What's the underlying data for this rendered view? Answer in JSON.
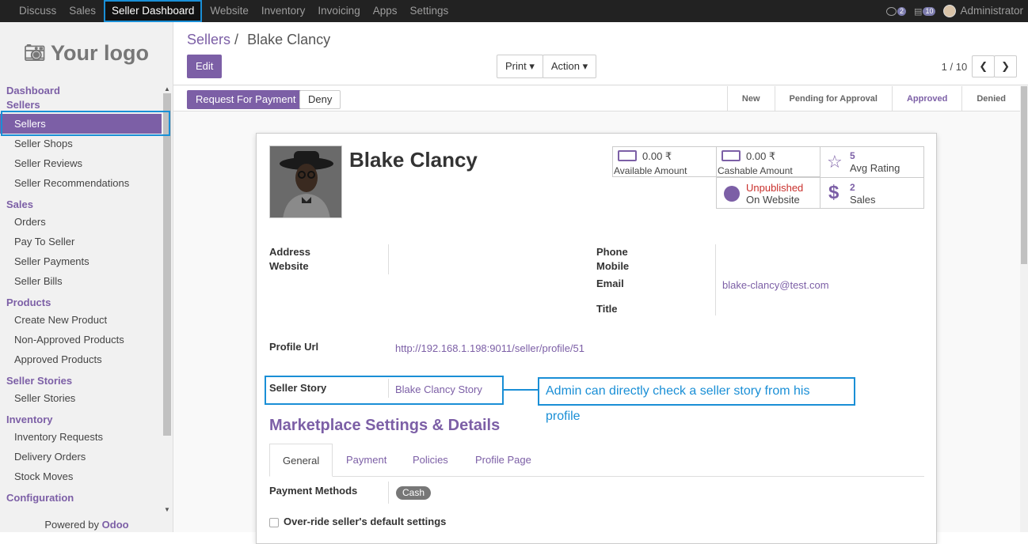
{
  "topbar": {
    "menu": [
      "Discuss",
      "Sales",
      "Seller Dashboard",
      "Website",
      "Inventory",
      "Invoicing",
      "Apps",
      "Settings"
    ],
    "active": "Seller Dashboard",
    "chat_count": "2",
    "activity_count": "10",
    "user": "Administrator"
  },
  "sidebar": {
    "logo": "Your logo",
    "sections": [
      {
        "header": "Dashboard",
        "items": []
      },
      {
        "header": "Sellers",
        "items": [
          "Sellers",
          "Seller Shops",
          "Seller Reviews",
          "Seller Recommendations"
        ]
      },
      {
        "header": "Sales",
        "items": [
          "Orders",
          "Pay To Seller",
          "Seller Payments",
          "Seller Bills"
        ]
      },
      {
        "header": "Products",
        "items": [
          "Create New Product",
          "Non-Approved Products",
          "Approved Products"
        ]
      },
      {
        "header": "Seller Stories",
        "items": [
          "Seller Stories"
        ]
      },
      {
        "header": "Inventory",
        "items": [
          "Inventory Requests",
          "Delivery Orders",
          "Stock Moves"
        ]
      },
      {
        "header": "Configuration",
        "items": []
      }
    ],
    "selected": "Sellers",
    "powered_prefix": "Powered by",
    "powered_brand": "Odoo"
  },
  "control": {
    "breadcrumb_root": "Sellers",
    "breadcrumb_sep": "/",
    "breadcrumb_current": "Blake Clancy",
    "edit": "Edit",
    "print": "Print",
    "action": "Action",
    "pager": "1 / 10"
  },
  "statusbar": {
    "request_payment": "Request For Payment",
    "deny": "Deny",
    "stages": [
      "New",
      "Pending for Approval",
      "Approved",
      "Denied"
    ],
    "current": "Approved"
  },
  "form": {
    "name": "Blake Clancy",
    "stats": {
      "available_amount": "0.00 ₹",
      "available_label": "Available Amount",
      "cashable_amount": "0.00 ₹",
      "cashable_label": "Cashable Amount",
      "rating_value": "5",
      "rating_label": "Avg Rating",
      "website_status": "Unpublished",
      "website_label": "On Website",
      "sales_value": "2",
      "sales_label": "Sales"
    },
    "labels": {
      "address": "Address",
      "website": "Website",
      "phone": "Phone",
      "mobile": "Mobile",
      "email": "Email",
      "title": "Title",
      "profile_url": "Profile Url",
      "seller_story": "Seller Story"
    },
    "values": {
      "email": "blake-clancy@test.com",
      "profile_url": "http://192.168.1.198:9011/seller/profile/51",
      "seller_story": "Blake Clancy Story"
    },
    "section_title": "Marketplace Settings & Details",
    "tabs": [
      "General",
      "Payment",
      "Policies",
      "Profile Page"
    ],
    "active_tab": "General",
    "payment_methods_label": "Payment Methods",
    "payment_method": "Cash",
    "override_label": "Over-ride seller's default settings"
  },
  "annotation": "Admin can directly check a seller story from his profile",
  "colors": {
    "brand": "#7c5fa6",
    "highlight": "#1a8fd6"
  }
}
